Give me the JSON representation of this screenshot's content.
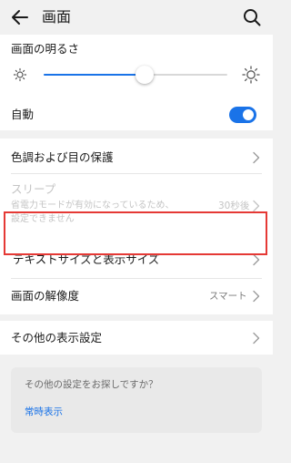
{
  "header": {
    "title": "画面",
    "back_icon": "back-arrow-icon",
    "search_icon": "search-icon"
  },
  "brightness": {
    "label": "画面の明るさ",
    "level": 0.55,
    "accent": "#1a73e8"
  },
  "auto": {
    "label": "自動",
    "on": true
  },
  "color": {
    "label": "色調および目の保護"
  },
  "sleep": {
    "label": "スリープ",
    "desc_line1": "省電力モードが有効になっているため、",
    "desc_line2": "設定できません",
    "value": "30秒後"
  },
  "text_size": {
    "label": "テキストサイズと表示サイズ",
    "highlight_color": "#e53935"
  },
  "resolution": {
    "label": "画面の解像度",
    "value": "スマート"
  },
  "other_display": {
    "label": "その他の表示設定"
  },
  "promo": {
    "question": "その他の設定をお探しですか？",
    "link": "常時表示"
  }
}
